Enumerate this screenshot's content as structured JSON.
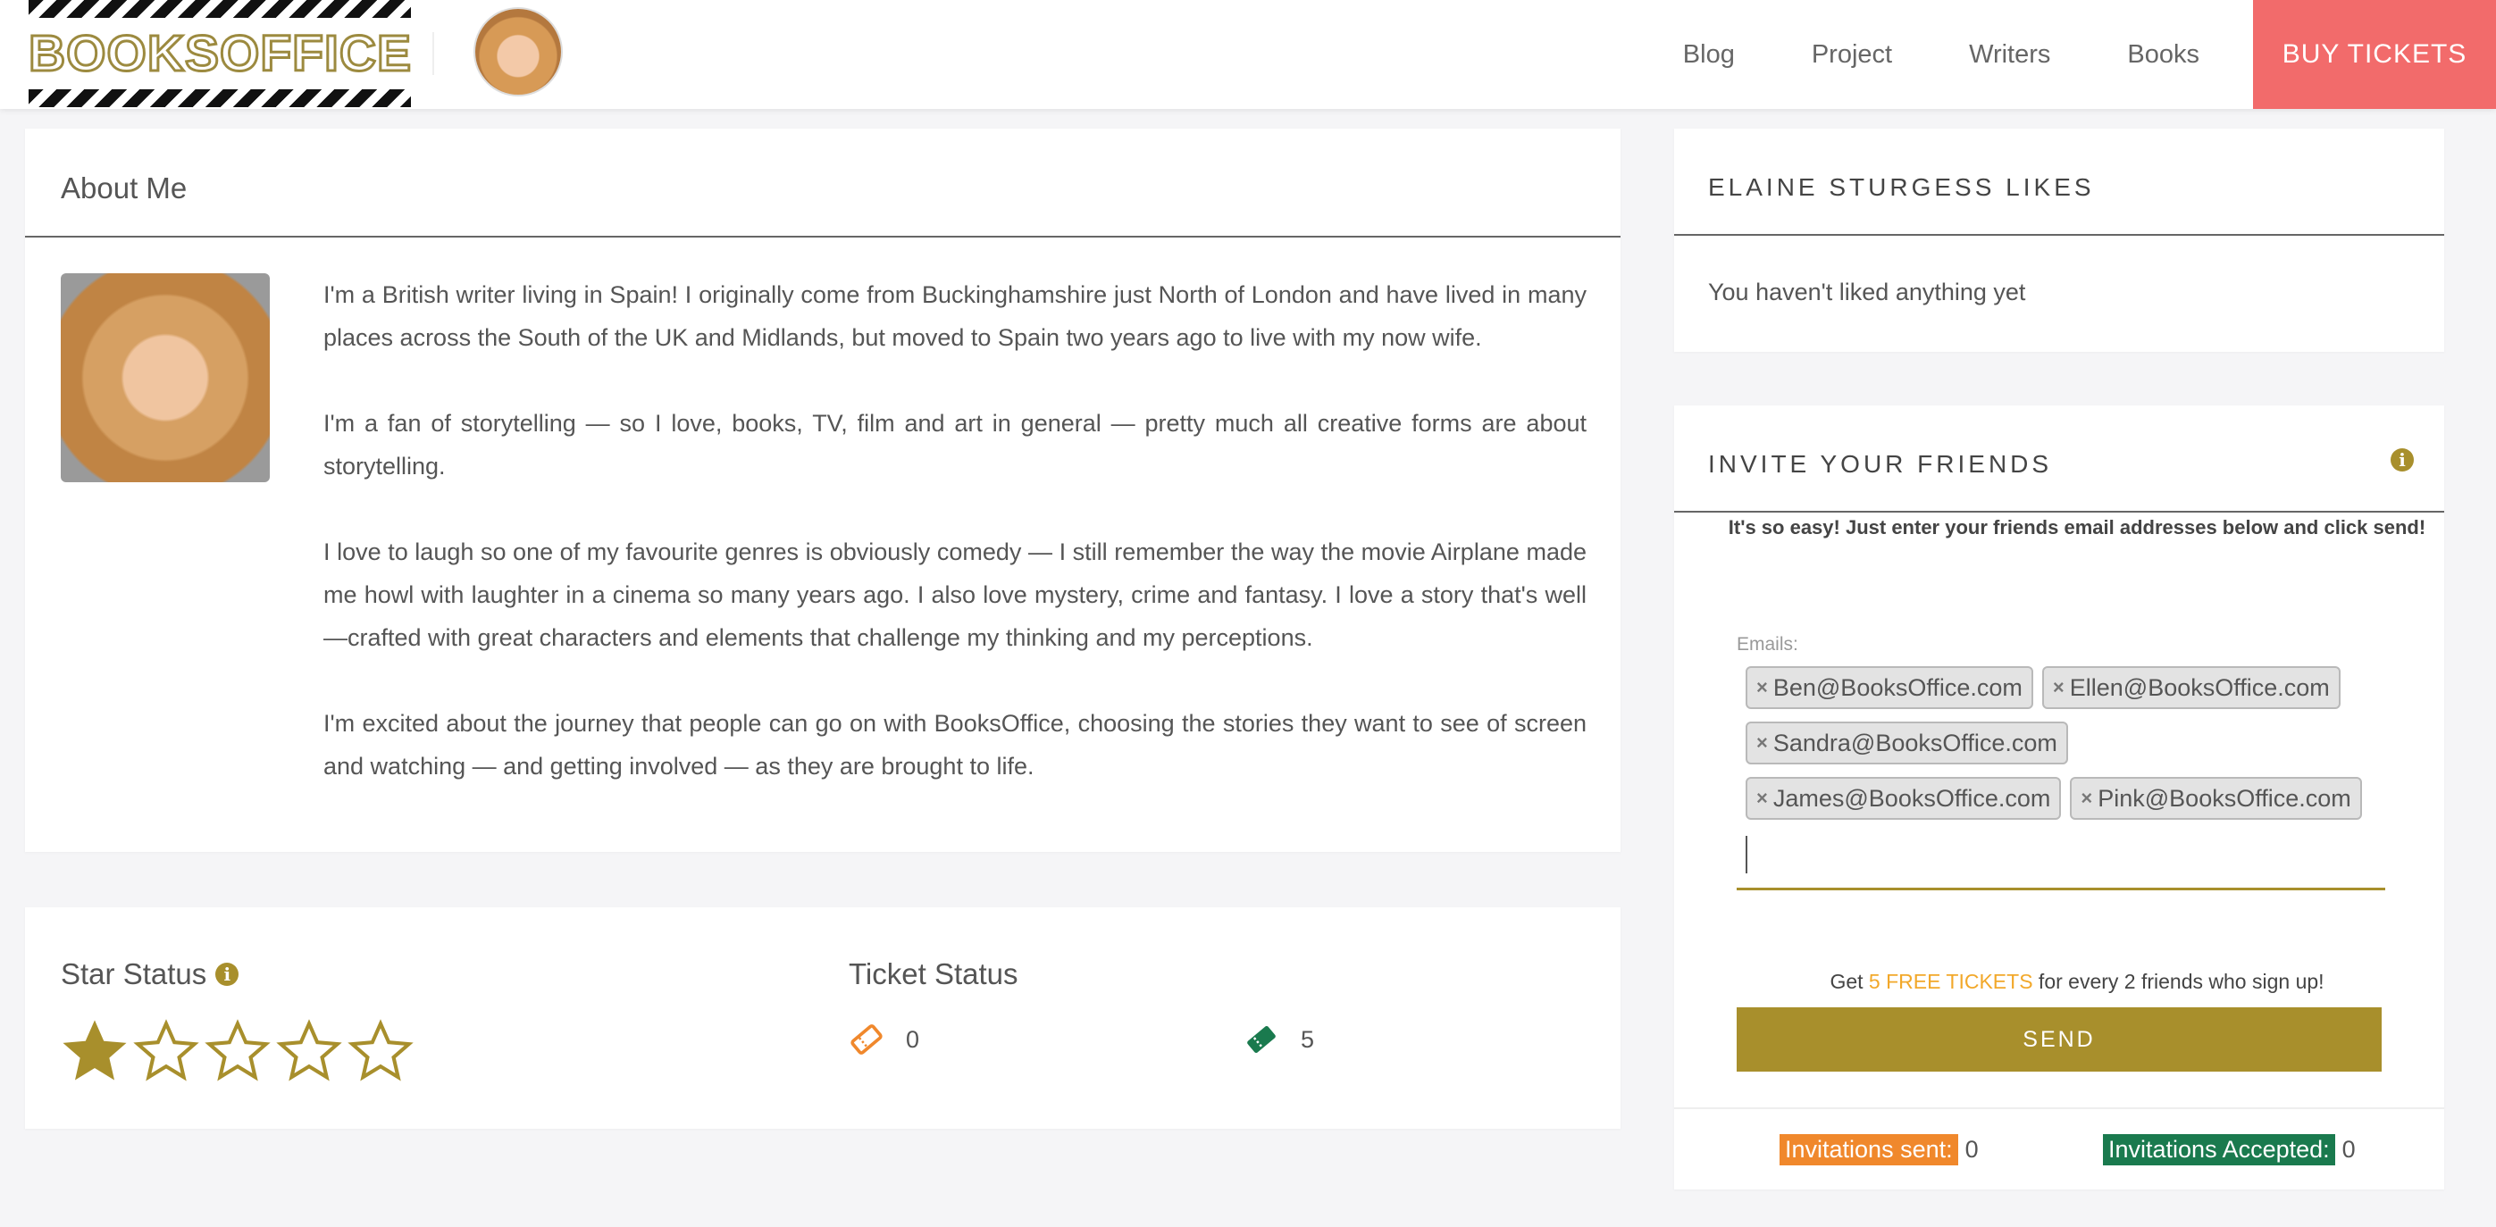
{
  "header": {
    "logo_text": "BOOKSOFFICE",
    "nav": [
      "Blog",
      "Project",
      "Writers",
      "Books"
    ],
    "cta": "BUY TICKETS"
  },
  "about": {
    "title": "About Me",
    "paragraphs": [
      "I'm a British writer living in Spain! I originally come from Buckinghamshire just North of London and have lived in many places across the South of the UK and Midlands, but moved to Spain two years ago to live with my now wife.",
      "I'm a fan of storytelling — so I love, books, TV, film and art in general — pretty much all creative forms are about storytelling.",
      "I love to laugh so one of my favourite genres is obviously comedy — I still remember the way the movie Airplane made me howl with laughter in a cinema so many years ago. I also love mystery, crime and fantasy. I love a story that's well—crafted with great characters and elements that challenge my thinking and my perceptions.",
      "I'm excited about the journey that people can go on with BooksOffice, choosing the stories they want to see of screen and watching — and getting involved — as they are brought to life."
    ]
  },
  "star_status": {
    "title": "Star Status",
    "rating": 1,
    "max": 5
  },
  "ticket_status": {
    "title": "Ticket Status",
    "used": "0",
    "available": "5",
    "colors": {
      "used": "#f0882c",
      "available": "#1a7a4e"
    }
  },
  "likes": {
    "title": "ELAINE STURGESS LIKES",
    "empty_text": "You haven't liked anything yet"
  },
  "invite": {
    "title": "INVITE YOUR FRIENDS",
    "intro": "It's so easy! Just enter your friends email addresses below and click send!",
    "emails_label": "Emails:",
    "emails": [
      "Ben@BooksOffice.com",
      "Ellen@BooksOffice.com",
      "Sandra@BooksOffice.com",
      "James@BooksOffice.com",
      "Pink@BooksOffice.com"
    ],
    "input_value": "",
    "promo_prefix": "Get ",
    "promo_highlight": "5 FREE TICKETS",
    "promo_suffix": " for every 2 friends who sign up!",
    "send_label": "SEND",
    "sent_label": "Invitations sent:",
    "sent_count": "0",
    "accepted_label": "Invitations Accepted:",
    "accepted_count": "0"
  },
  "colors": {
    "accent": "#a88f2c",
    "cta": "#f26b6b",
    "promo": "#f2a82a"
  }
}
